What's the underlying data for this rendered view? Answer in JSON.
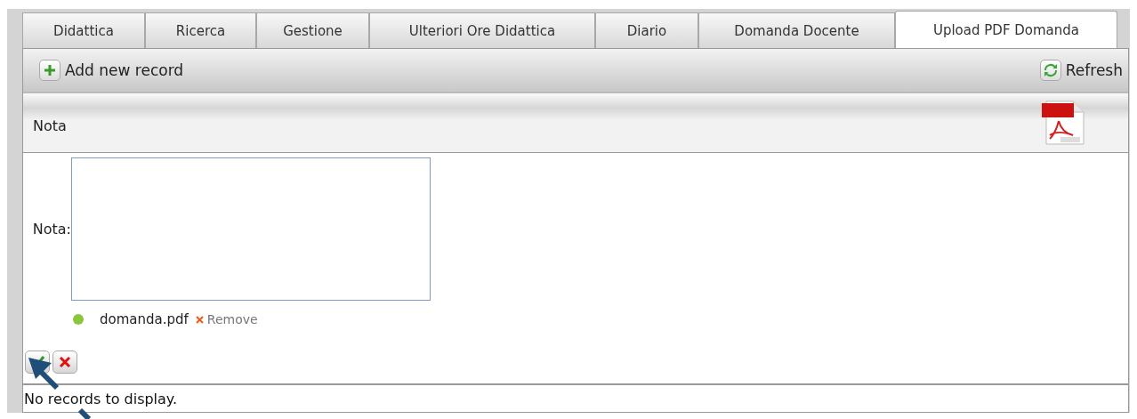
{
  "tabs": [
    {
      "label": "Didattica",
      "selected": false
    },
    {
      "label": "Ricerca",
      "selected": false
    },
    {
      "label": "Gestione",
      "selected": false
    },
    {
      "label": "Ulteriori Ore Didattica",
      "selected": false
    },
    {
      "label": "Diario",
      "selected": false
    },
    {
      "label": "Domanda Docente",
      "selected": false
    },
    {
      "label": "Upload PDF Domanda",
      "selected": true
    }
  ],
  "toolbar": {
    "add_label": "Add new record",
    "refresh_label": "Refresh"
  },
  "header": {
    "column_1": "Nota"
  },
  "edit_form": {
    "field_label": "Nota:",
    "file": {
      "name": "domanda.pdf",
      "remove_label": "Remove",
      "color": "#8cc63f"
    }
  },
  "status": "No records to display."
}
